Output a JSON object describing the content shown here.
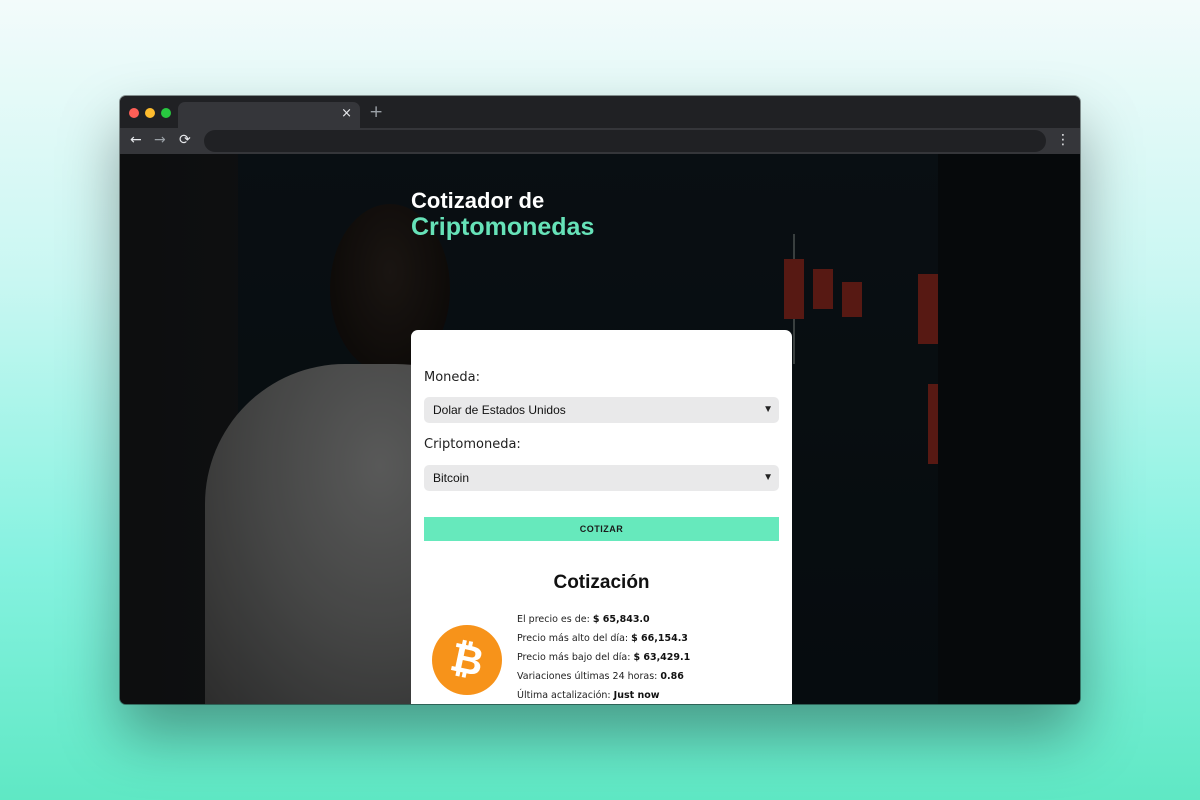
{
  "browser": {
    "tab_close": "×",
    "new_tab": "+",
    "back": "←",
    "forward": "→",
    "reload": "⟳",
    "menu": "⋮"
  },
  "app": {
    "title_line1": "Cotizador de",
    "title_line2": "Criptomonedas",
    "accent_color": "#66e2b8"
  },
  "form": {
    "currency_label": "Moneda:",
    "currency_selected": "Dolar de Estados Unidos",
    "crypto_label": "Criptomoneda:",
    "crypto_selected": "Bitcoin",
    "submit_label": "COTIZAR"
  },
  "result": {
    "title": "Cotización",
    "coin_icon": "bitcoin-icon",
    "coin_symbol": "₿",
    "price_label": "El precio es de:",
    "price_value": "$ 65,843.0",
    "high_label": "Precio más alto del día:",
    "high_value": "$ 66,154.3",
    "low_label": "Precio más bajo del día:",
    "low_value": "$ 63,429.1",
    "change_label": "Variaciones últimas 24 horas:",
    "change_value": "0.86",
    "updated_label": "Última actalización:",
    "updated_value": "Just now"
  }
}
